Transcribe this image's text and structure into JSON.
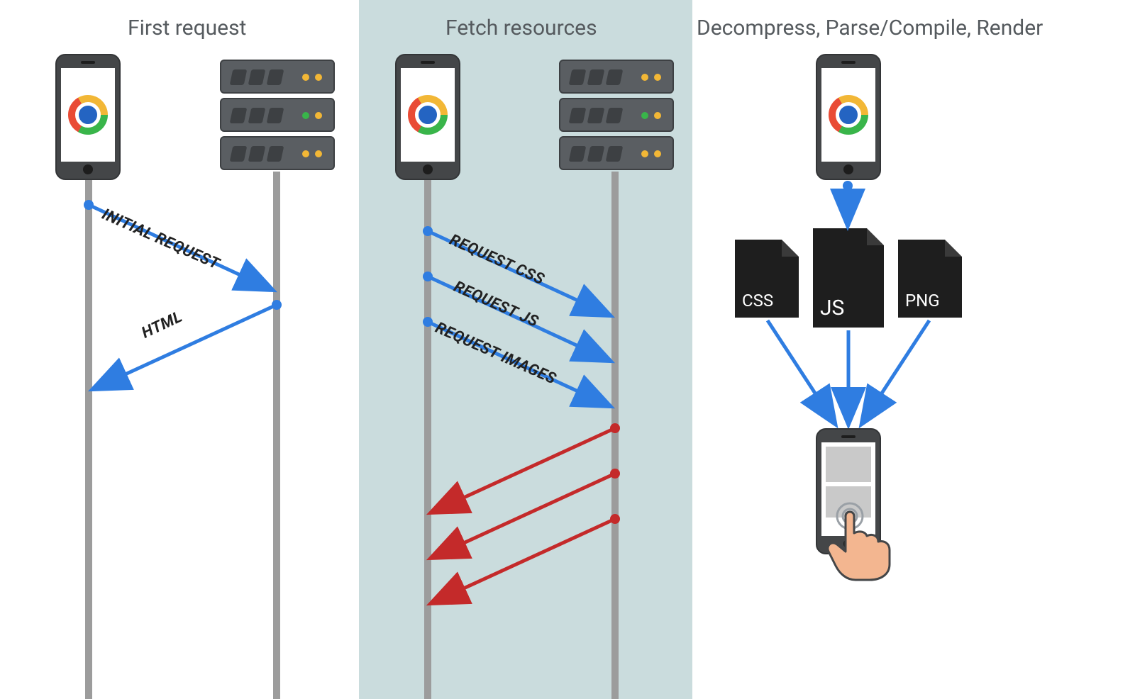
{
  "panels": {
    "first": {
      "title": "First request"
    },
    "fetch": {
      "title": "Fetch resources"
    },
    "render": {
      "title": "Decompress, Parse/Compile, Render"
    }
  },
  "messages": {
    "initial_request": "INITIAL REQUEST",
    "html": "HTML",
    "request_css": "REQUEST CSS",
    "request_js": "REQUEST JS",
    "request_images": "REQUEST IMAGES"
  },
  "files": {
    "css": "CSS",
    "js": "JS",
    "png": "PNG"
  },
  "colors": {
    "request_arrow": "#2f7de1",
    "response_arrow": "#c42a2a",
    "lifeline": "#9c9c9c",
    "fetch_bg": "#cadcdd"
  }
}
